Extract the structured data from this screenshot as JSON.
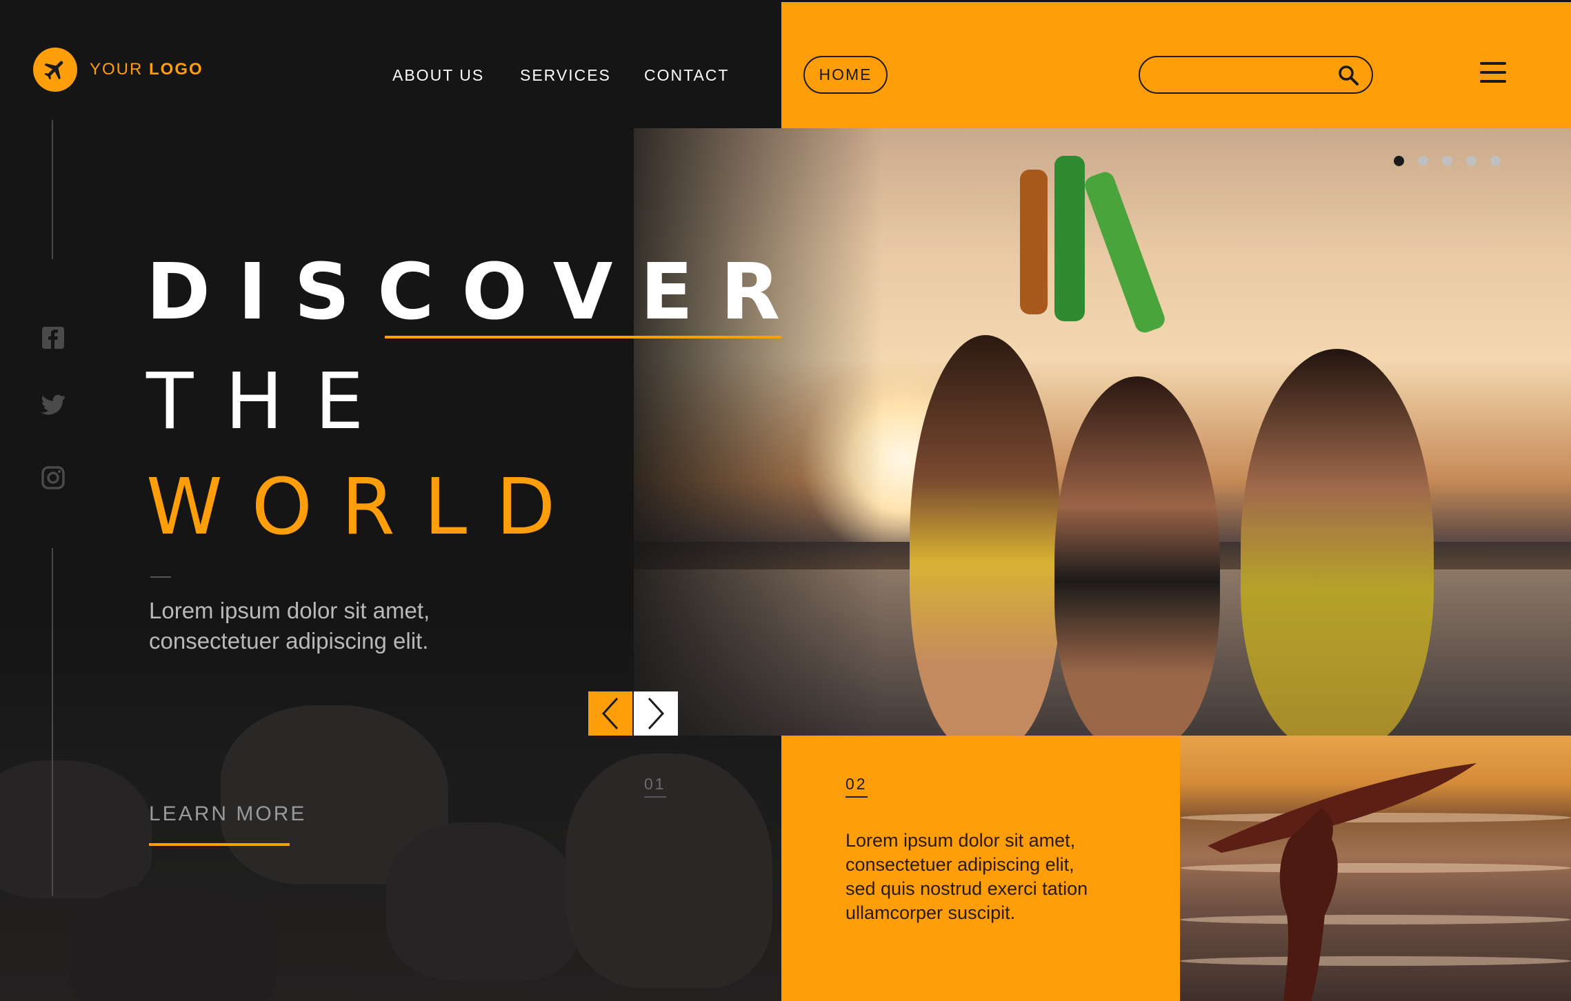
{
  "brand": {
    "logo_text_light": "YOUR",
    "logo_text_bold": "LOGO",
    "accent_color": "#ff9e0b",
    "dark_color": "#151515"
  },
  "nav": {
    "about": "ABOUT US",
    "services": "SERVICES",
    "contact": "CONTACT",
    "home": "HOME"
  },
  "search": {
    "placeholder": "",
    "icon": "search-icon"
  },
  "menu": {
    "icon": "hamburger-menu-icon"
  },
  "social": [
    "facebook-icon",
    "twitter-icon",
    "instagram-icon"
  ],
  "hero": {
    "line1": "DISCOVER",
    "line2": "THE",
    "line3": "WORLD",
    "description_line1": "Lorem ipsum dolor sit amet,",
    "description_line2": "consectetuer adipiscing elit.",
    "learn_more": "LEARN MORE",
    "slide_number": "01"
  },
  "slider": {
    "dot_count": 5,
    "active_dot": 1
  },
  "card": {
    "number": "02",
    "line1": "Lorem ipsum dolor sit amet,",
    "line2": "consectetuer adipiscing elit,",
    "line3": "sed quis nostrud exerci tation",
    "line4": "ullamcorper suscipit."
  }
}
